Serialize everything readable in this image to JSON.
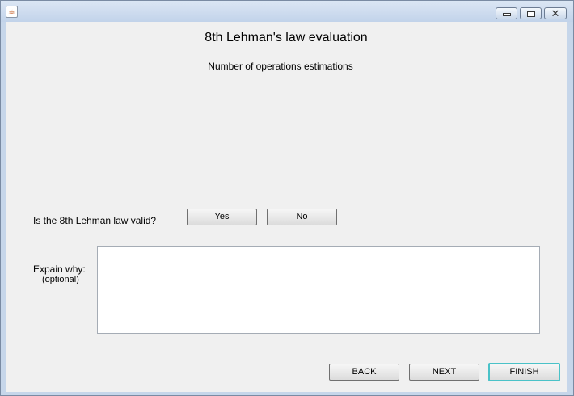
{
  "window": {
    "app_icon": "java-coffee-icon",
    "controls": {
      "minimize": "minimize-icon",
      "maximize": "maximize-icon",
      "close": "close-icon"
    }
  },
  "form": {
    "title": "8th Lehman's law evaluation",
    "subtitle": "Number of operations estimations",
    "question": "Is the 8th Lehman law valid?",
    "yes_label": "Yes",
    "no_label": "No",
    "explain_label": "Expain why:",
    "optional_label": "(optional)",
    "explain_value": ""
  },
  "navigation": {
    "back_label": "BACK",
    "next_label": "NEXT",
    "finish_label": "FINISH"
  }
}
